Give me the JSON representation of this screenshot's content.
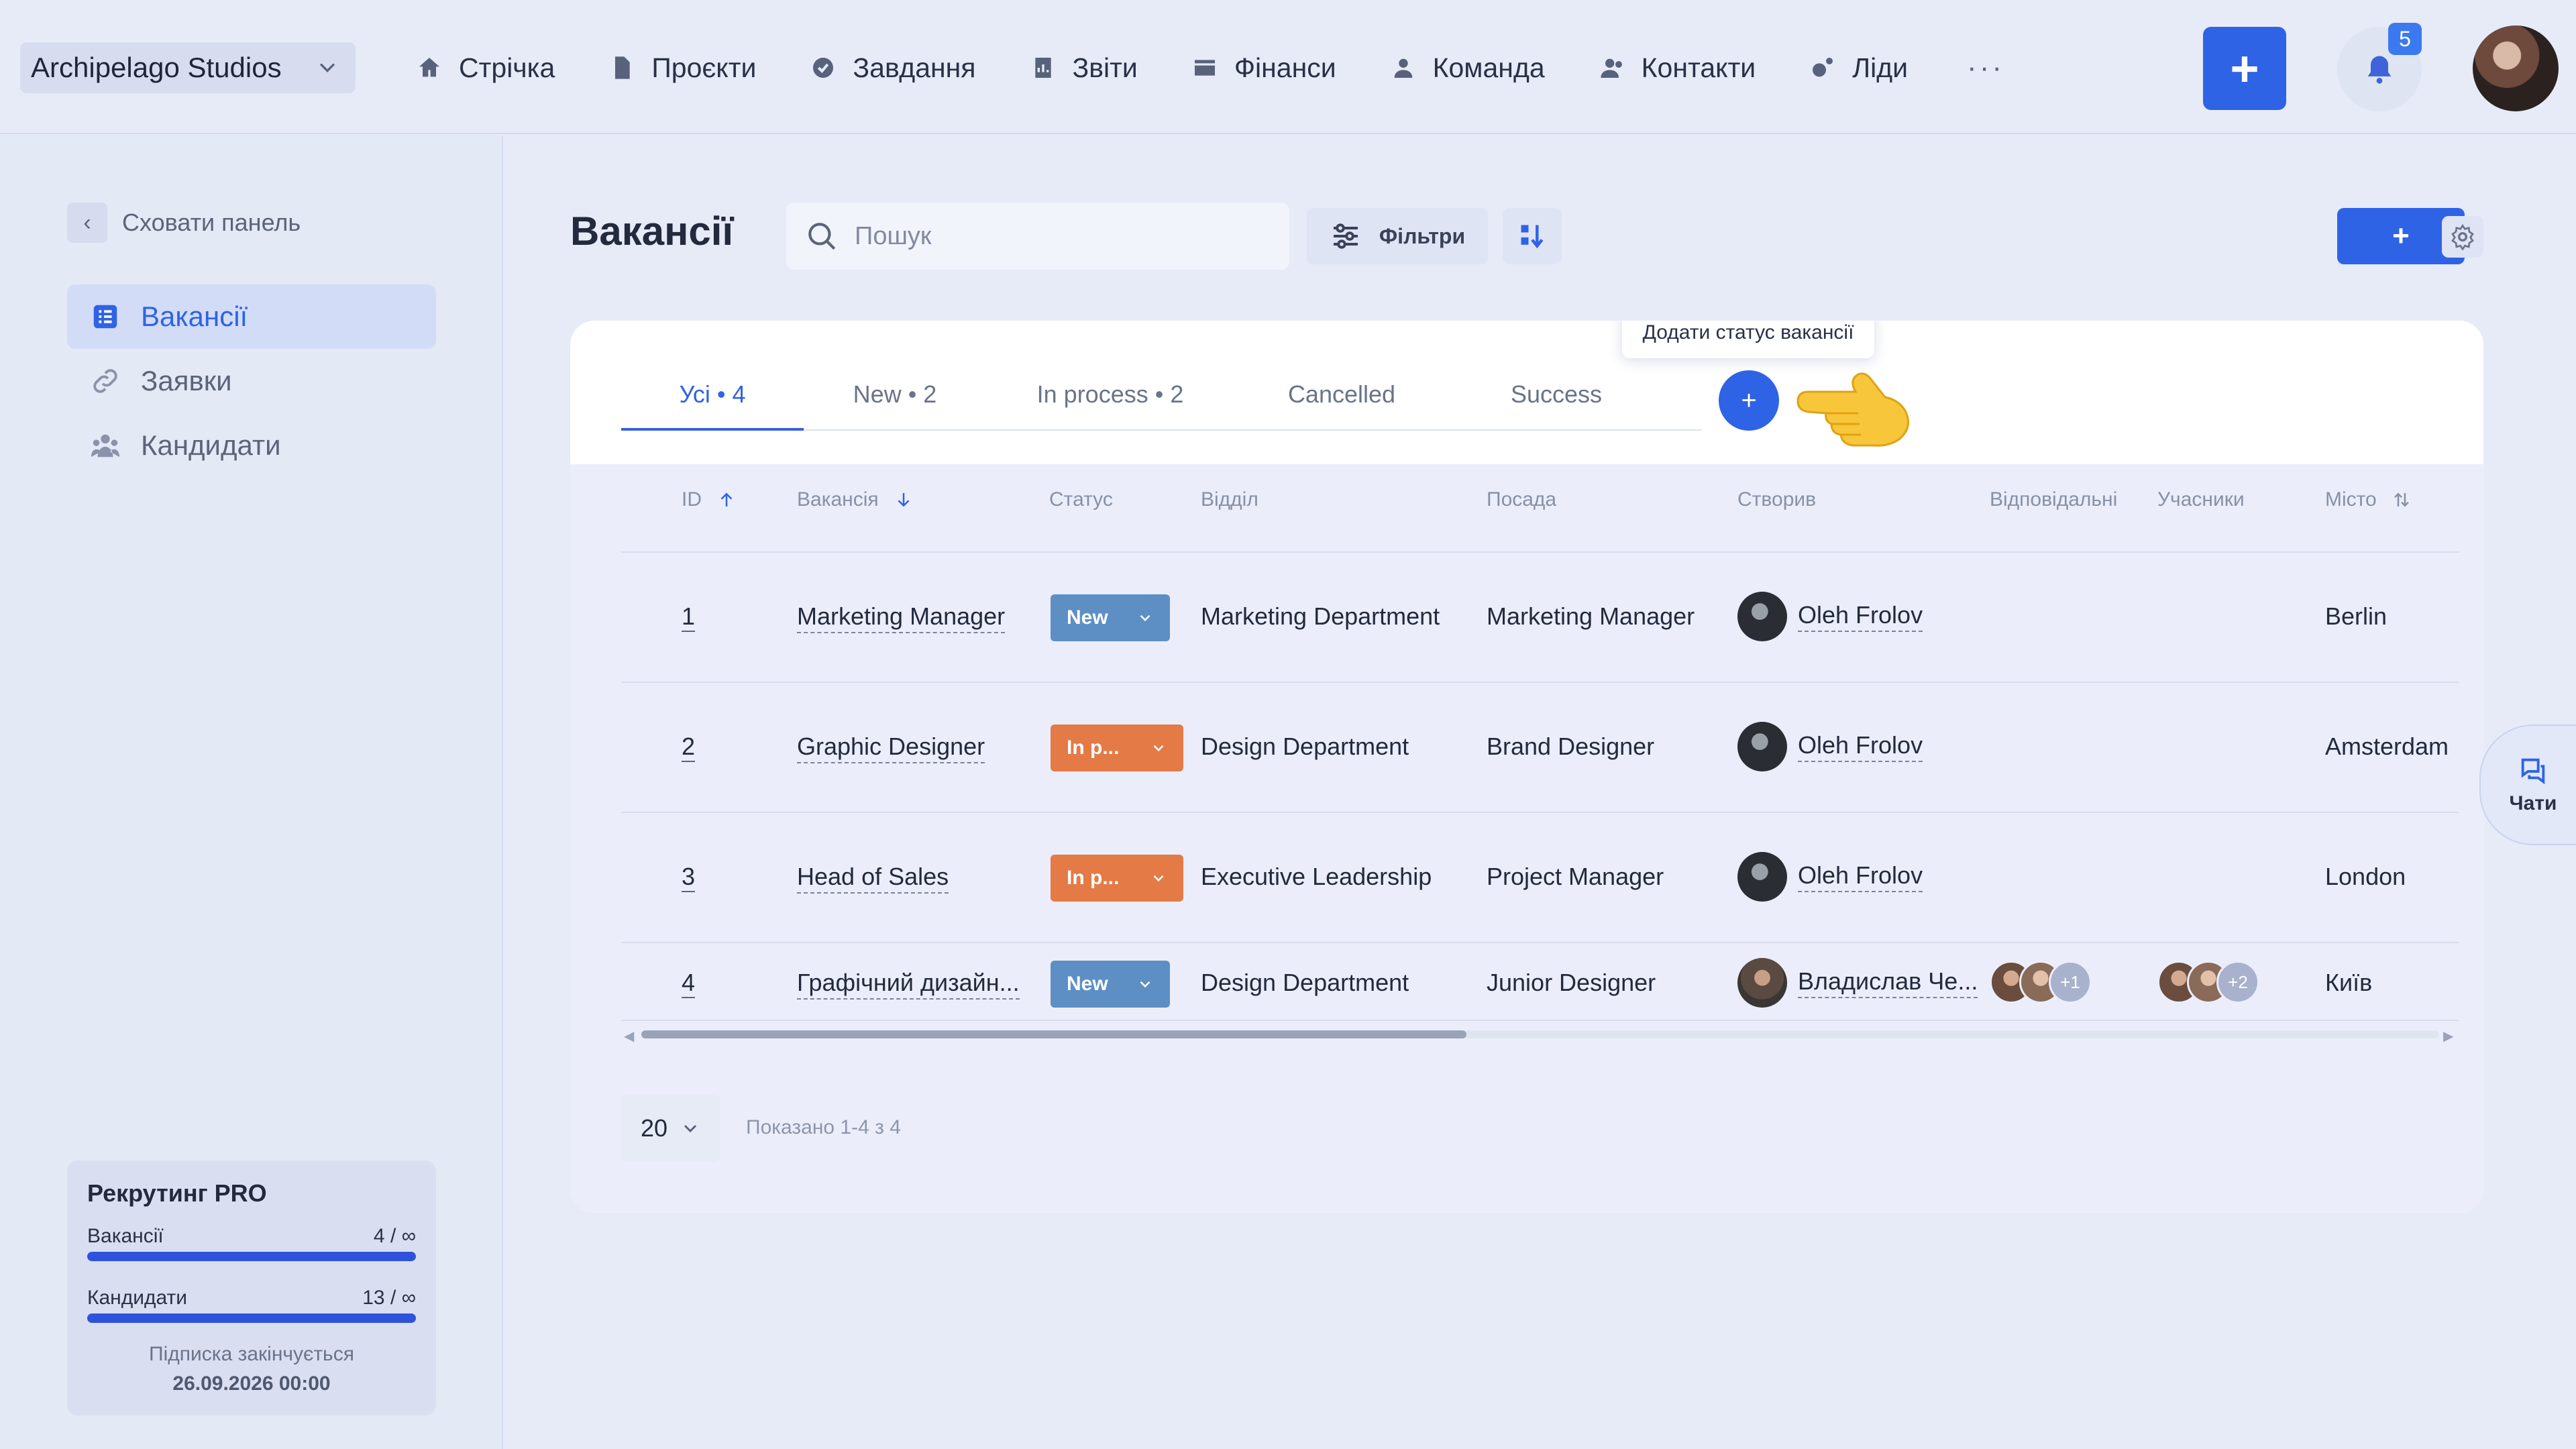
{
  "workspace": {
    "name": "Archipelago Studios"
  },
  "nav": {
    "items": [
      {
        "label": "Стрічка",
        "icon": "home-icon"
      },
      {
        "label": "Проєкти",
        "icon": "document-icon"
      },
      {
        "label": "Завдання",
        "icon": "check-circle-icon"
      },
      {
        "label": "Звіти",
        "icon": "report-icon"
      },
      {
        "label": "Фінанси",
        "icon": "wallet-icon"
      },
      {
        "label": "Команда",
        "icon": "person-icon"
      },
      {
        "label": "Контакти",
        "icon": "contacts-icon"
      },
      {
        "label": "Ліди",
        "icon": "leads-icon"
      }
    ],
    "more": "···",
    "add": "+",
    "notifications_count": "5"
  },
  "sidebar": {
    "hide_label": "Сховати панель",
    "items": [
      {
        "label": "Вакансії",
        "icon": "list-icon",
        "active": true
      },
      {
        "label": "Заявки",
        "icon": "link-icon",
        "active": false
      },
      {
        "label": "Кандидати",
        "icon": "users-icon",
        "active": false
      }
    ],
    "plan": {
      "title": "Рекрутинг PRO",
      "rows": [
        {
          "label": "Вакансії",
          "value": "4 / ∞"
        },
        {
          "label": "Кандидати",
          "value": "13 / ∞"
        }
      ],
      "expires_label": "Підписка закінчується",
      "expires_date": "26.09.2026 00:00"
    }
  },
  "main": {
    "title": "Вакансії",
    "search_placeholder": "Пошук",
    "filters_label": "Фільтри",
    "add_label": "+",
    "tabs": [
      {
        "label": "Усі • 4",
        "active": true
      },
      {
        "label": "New • 2",
        "active": false
      },
      {
        "label": "In process • 2",
        "active": false
      },
      {
        "label": "Cancelled",
        "active": false
      },
      {
        "label": "Success",
        "active": false
      }
    ],
    "add_status_tooltip": "Додати статус вакансії",
    "add_status_label": "+",
    "columns": [
      "ID",
      "Вакансія",
      "Статус",
      "Відділ",
      "Посада",
      "Створив",
      "Відповідальні",
      "Учасники",
      "Місто"
    ],
    "rows": [
      {
        "id": "1",
        "vacancy": "Marketing Manager",
        "status": "New",
        "status_color": "#5d8fc4",
        "department": "Marketing Department",
        "position": "Marketing Manager",
        "creator": "Oleh Frolov",
        "city": "Berlin"
      },
      {
        "id": "2",
        "vacancy": "Graphic Designer",
        "status": "In p...",
        "status_color": "#e47a45",
        "department": "Design Department",
        "position": "Brand Designer",
        "creator": "Oleh Frolov",
        "city": "Amsterdam"
      },
      {
        "id": "3",
        "vacancy": "Head of Sales",
        "status": "In p...",
        "status_color": "#e47a45",
        "department": "Executive Leadership",
        "position": "Project Manager",
        "creator": "Oleh Frolov",
        "city": "London"
      },
      {
        "id": "4",
        "vacancy": "Графічний дизайн...",
        "status": "New",
        "status_color": "#5d8fc4",
        "department": "Design Department",
        "position": "Junior Designer",
        "creator": "Владислав Че...",
        "responsible_more": "+1",
        "participants_more": "+2",
        "city": "Київ"
      }
    ],
    "page_size": "20",
    "shown": "Показано 1-4 з 4"
  },
  "chats": {
    "label": "Чати"
  },
  "colors": {
    "accent": "#2f63e6",
    "new": "#5d8fc4",
    "in_process": "#e47a45"
  }
}
